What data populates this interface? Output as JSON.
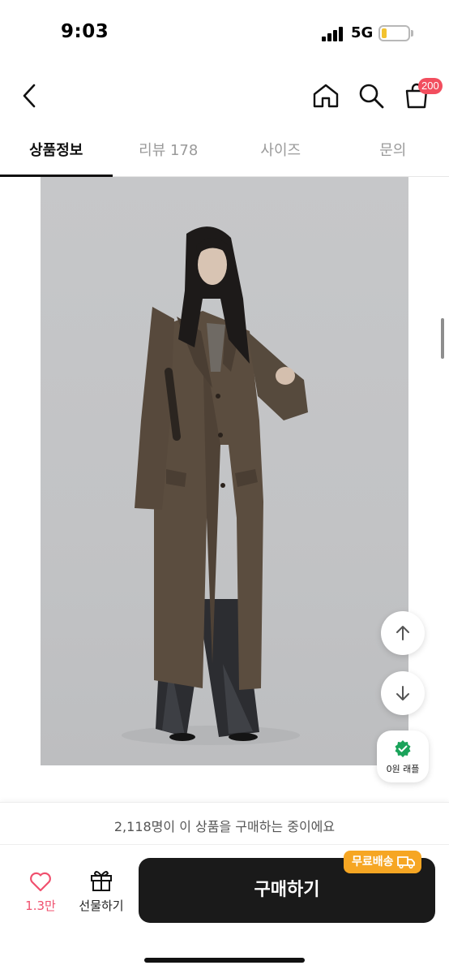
{
  "status_bar": {
    "time": "9:03",
    "network": "5G",
    "battery_level": 0.2,
    "battery_color": "#f2c230"
  },
  "nav": {
    "back_icon": "chevron-left-icon",
    "home_icon": "home-icon",
    "search_icon": "search-icon",
    "cart_icon": "shopping-bag-icon",
    "cart_badge": "200",
    "badge_color": "#f24e5e"
  },
  "tabs": [
    {
      "label": "상품정보",
      "active": true
    },
    {
      "label": "리뷰 178",
      "active": false
    },
    {
      "label": "사이즈",
      "active": false
    },
    {
      "label": "문의",
      "active": false
    }
  ],
  "floating": {
    "scroll_up_icon": "arrow-up-icon",
    "scroll_down_icon": "arrow-down-icon",
    "raffle_icon": "check-badge-icon",
    "raffle_label": "0원 래플",
    "raffle_color": "#1aa35a"
  },
  "buyers_notice": "2,118명이 이 상품을 구매하는 중이에요",
  "actions": {
    "like_icon": "heart-icon",
    "like_count": "1.3만",
    "like_color": "#f0506e",
    "gift_icon": "gift-icon",
    "gift_label": "선물하기",
    "buy_label": "구매하기",
    "buy_color": "#1a1a1a",
    "shipping_badge": "무료배송",
    "shipping_icon": "truck-icon",
    "shipping_color": "#f6a623"
  }
}
